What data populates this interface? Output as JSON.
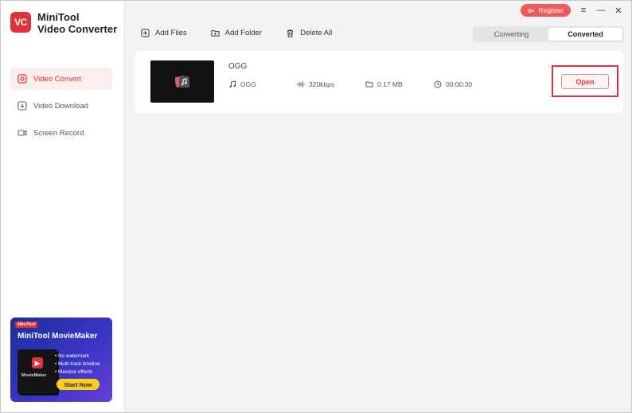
{
  "app": {
    "logo_text": "VC",
    "title_line1": "MiniTool",
    "title_line2": "Video Converter"
  },
  "sidebar": {
    "items": [
      {
        "label": "Video Convert",
        "icon": "convert-icon",
        "active": true
      },
      {
        "label": "Video Download",
        "icon": "download-icon",
        "active": false
      },
      {
        "label": "Screen Record",
        "icon": "camera-icon",
        "active": false
      }
    ]
  },
  "promo": {
    "badge": "MiniTool",
    "title": "MiniTool MovieMaker",
    "box_name": "MovieMaker",
    "features": [
      "No watermark",
      "Multi-track timeline",
      "Massive effects"
    ],
    "button": "Start Now"
  },
  "window": {
    "register_label": "Register",
    "menu_glyph": "≡",
    "minimize_glyph": "—",
    "close_glyph": "✕"
  },
  "toolbar": {
    "add_files": "Add Files",
    "add_folder": "Add Folder",
    "delete_all": "Delete All"
  },
  "tabs": {
    "converting": "Converting",
    "converted": "Converted",
    "selected": "converted"
  },
  "file": {
    "name": "OGG",
    "format": "OGG",
    "bitrate": "320kbps",
    "size": "0.17 MB",
    "duration": "00:00:30",
    "open_label": "Open"
  },
  "colors": {
    "accent": "#e3313c",
    "register": "#ef5b5b",
    "promo_button": "#ffcf1f"
  }
}
